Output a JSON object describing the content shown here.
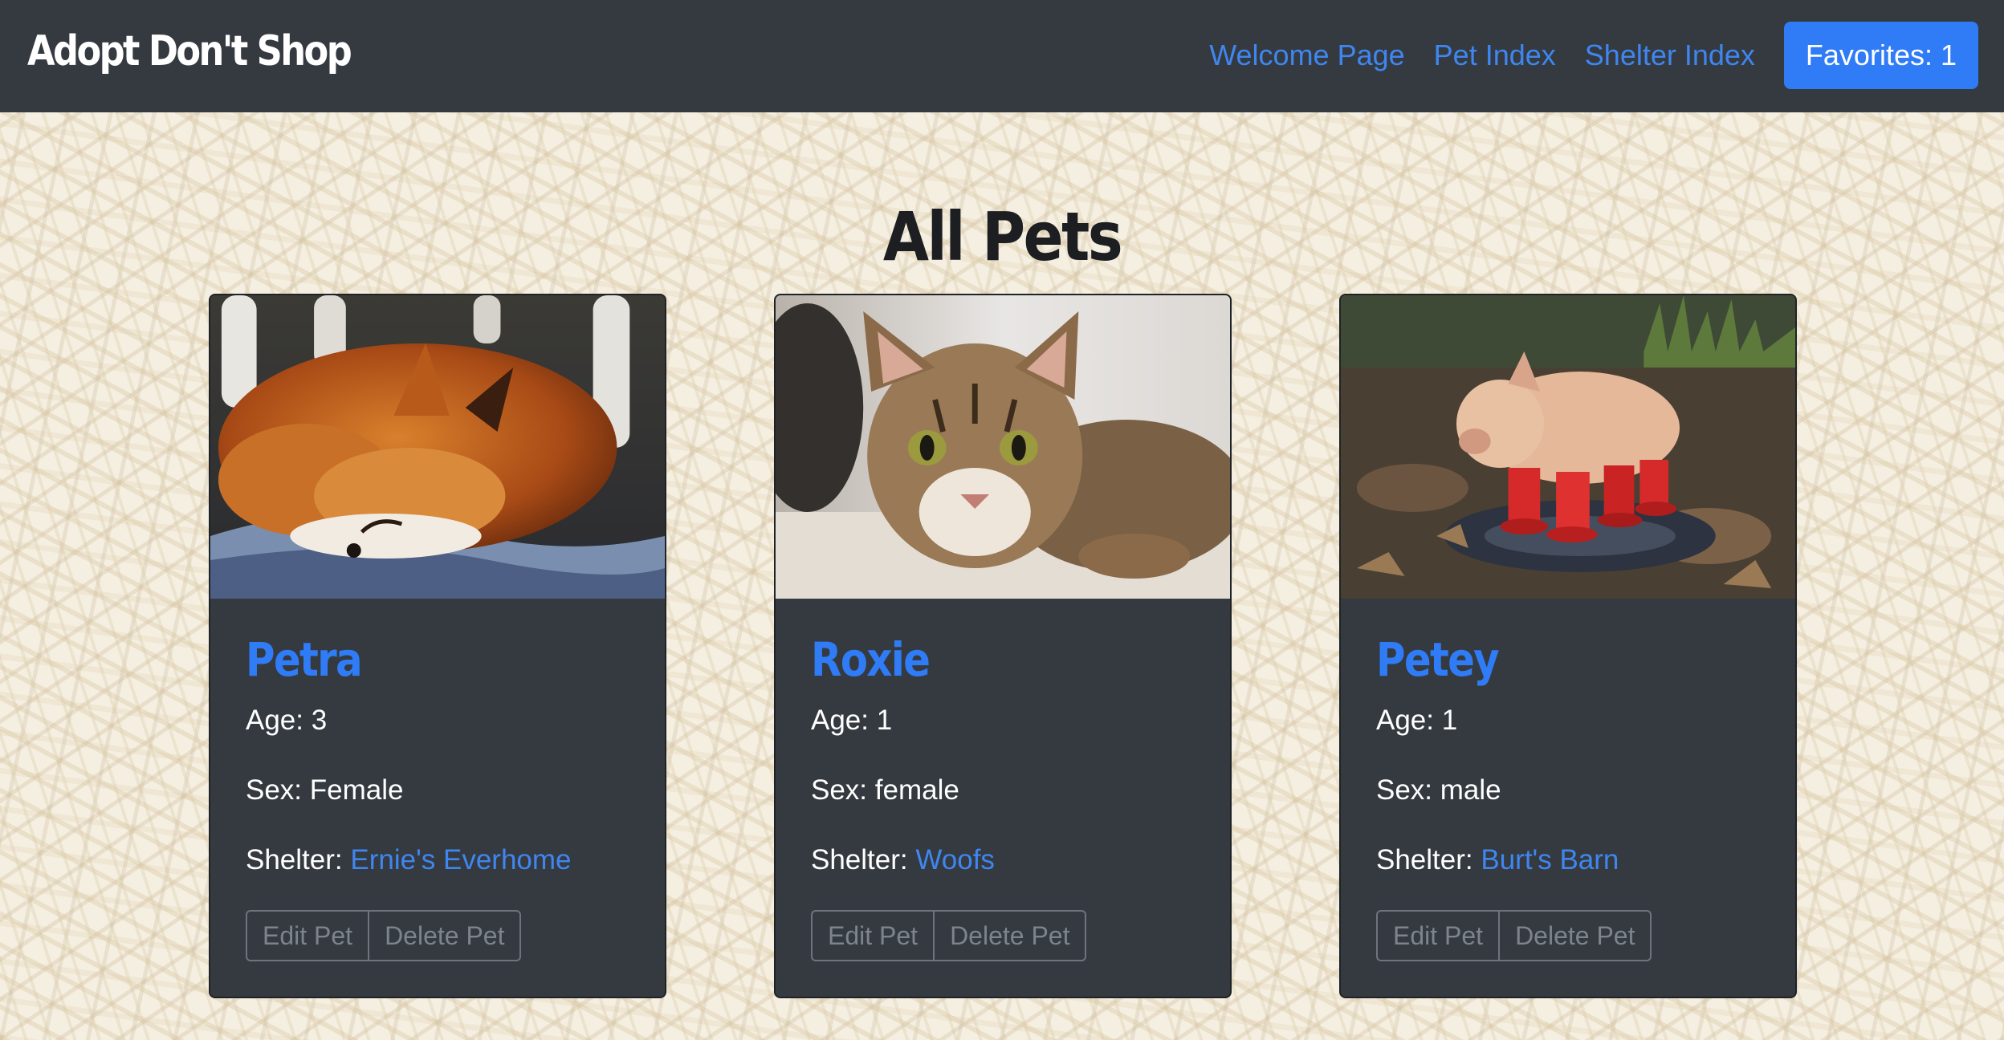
{
  "nav": {
    "brand": "Adopt Don't Shop",
    "links": [
      "Welcome Page",
      "Pet Index",
      "Shelter Index"
    ],
    "favorites_label": "Favorites: 1",
    "accent": "#2f7cf6",
    "bar_color": "#343a40"
  },
  "page": {
    "title": "All Pets"
  },
  "pets": [
    {
      "name": "Petra",
      "age": "Age: 3",
      "sex": "Sex: Female",
      "shelter_label": "Shelter:",
      "shelter": "Ernie's Everhome",
      "edit_label": "Edit Pet",
      "delete_label": "Delete Pet",
      "image_alt": "sleeping-fox-photo"
    },
    {
      "name": "Roxie",
      "age": "Age: 1",
      "sex": "Sex: female",
      "shelter_label": "Shelter:",
      "shelter": "Woofs",
      "edit_label": "Edit Pet",
      "delete_label": "Delete Pet",
      "image_alt": "tabby-cat-photo"
    },
    {
      "name": "Petey",
      "age": "Age: 1",
      "sex": "Sex: male",
      "shelter_label": "Shelter:",
      "shelter": "Burt's Barn",
      "edit_label": "Edit Pet",
      "delete_label": "Delete Pet",
      "image_alt": "pig-in-red-boots-photo"
    }
  ]
}
